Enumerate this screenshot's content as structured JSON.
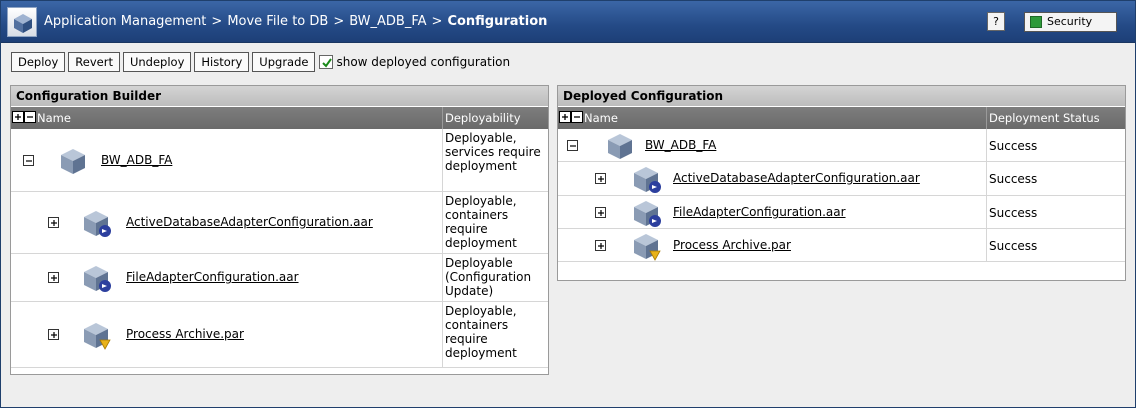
{
  "header": {
    "breadcrumb": [
      "Application Management",
      "Move File to DB",
      "BW_ADB_FA"
    ],
    "separator": ">",
    "current": "Configuration",
    "help_label": "?",
    "security_label": "Security"
  },
  "toolbar": {
    "buttons": [
      "Deploy",
      "Revert",
      "Undeploy",
      "History",
      "Upgrade"
    ],
    "show_deployed_label": "show deployed configuration",
    "show_deployed_checked": true
  },
  "builder": {
    "title": "Configuration Builder",
    "columns": [
      "Name",
      "Deployability"
    ],
    "rows": [
      {
        "name": "BW_ADB_FA",
        "status": "Deployable, services require deployment",
        "expanded": true,
        "icon": "application-icon"
      },
      {
        "name": "ActiveDatabaseAdapterConfiguration.aar",
        "status": "Deployable, containers require deployment",
        "expanded": false,
        "icon": "adapter-archive-icon"
      },
      {
        "name": "FileAdapterConfiguration.aar",
        "status": "Deployable (Configuration Update)",
        "expanded": false,
        "icon": "adapter-archive-icon"
      },
      {
        "name": "Process Archive.par",
        "status": "Deployable, containers require deployment",
        "expanded": false,
        "icon": "process-archive-icon"
      }
    ]
  },
  "deployed": {
    "title": "Deployed Configuration",
    "columns": [
      "Name",
      "Deployment Status"
    ],
    "rows": [
      {
        "name": "BW_ADB_FA",
        "status": "Success",
        "expanded": true,
        "icon": "application-icon"
      },
      {
        "name": "ActiveDatabaseAdapterConfiguration.aar",
        "status": "Success",
        "expanded": false,
        "icon": "adapter-archive-icon"
      },
      {
        "name": "FileAdapterConfiguration.aar",
        "status": "Success",
        "expanded": false,
        "icon": "adapter-archive-icon"
      },
      {
        "name": "Process Archive.par",
        "status": "Success",
        "expanded": false,
        "icon": "process-archive-icon"
      }
    ]
  },
  "colors": {
    "title_bar": "#2b528f",
    "grid_header": "#747474",
    "panel_header": "#c8c8c8"
  }
}
